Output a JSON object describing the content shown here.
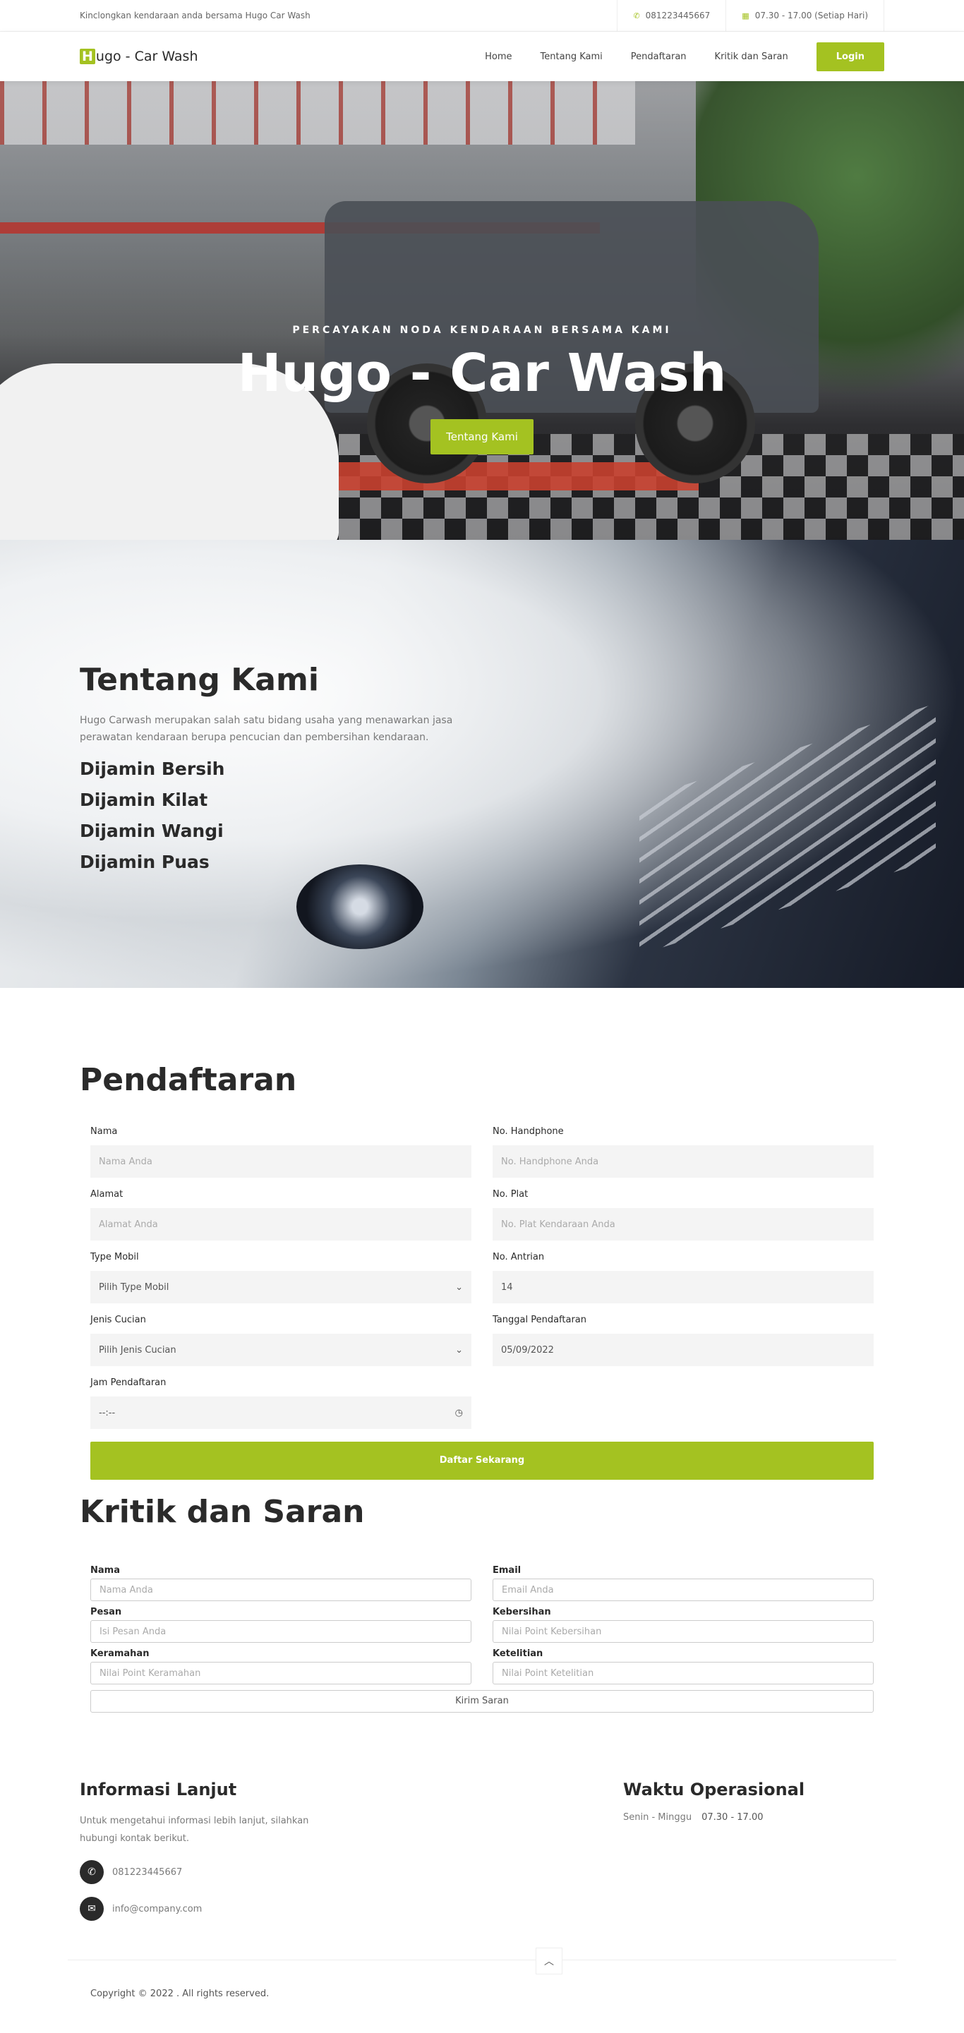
{
  "topbar": {
    "tagline": "Kinclongkan kendaraan anda bersama Hugo Car Wash",
    "phone": "081223445667",
    "hours": "07.30 - 17.00 (Setiap Hari)"
  },
  "nav": {
    "logo_mark": "H",
    "logo_text": "ugo - Car Wash",
    "links": [
      "Home",
      "Tentang Kami",
      "Pendaftaran",
      "Kritik dan Saran"
    ],
    "login": "Login"
  },
  "hero": {
    "subtitle": "PERCAYAKAN NODA KENDARAAN BERSAMA KAMI",
    "title": "Hugo - Car Wash",
    "button": "Tentang Kami",
    "slides": 3,
    "active_slide": 1
  },
  "about": {
    "title": "Tentang Kami",
    "description": "Hugo Carwash merupakan salah satu bidang usaha yang menawarkan jasa perawatan kendaraan berupa pencucian dan pembersihan kendaraan.",
    "points": [
      "Dijamin Bersih",
      "Dijamin Kilat",
      "Dijamin Wangi",
      "Dijamin Puas"
    ]
  },
  "pendaftaran": {
    "title": "Pendaftaran",
    "fields": {
      "nama": {
        "label": "Nama",
        "placeholder": "Nama Anda"
      },
      "hp": {
        "label": "No. Handphone",
        "placeholder": "No. Handphone Anda"
      },
      "alamat": {
        "label": "Alamat",
        "placeholder": "Alamat Anda"
      },
      "plat": {
        "label": "No. Plat",
        "placeholder": "No. Plat Kendaraan Anda"
      },
      "type": {
        "label": "Type Mobil",
        "value": "Pilih Type Mobil"
      },
      "antrian": {
        "label": "No. Antrian",
        "value": "14"
      },
      "jenis": {
        "label": "Jenis Cucian",
        "value": "Pilih Jenis Cucian"
      },
      "tanggal": {
        "label": "Tanggal Pendaftaran",
        "value": "05/09/2022"
      },
      "jam": {
        "label": "Jam Pendaftaran",
        "value": "--:--"
      }
    },
    "submit": "Daftar Sekarang"
  },
  "kritik": {
    "title": "Kritik dan Saran",
    "fields": {
      "nama": {
        "label": "Nama",
        "placeholder": "Nama Anda"
      },
      "email": {
        "label": "Email",
        "placeholder": "Email Anda"
      },
      "pesan": {
        "label": "Pesan",
        "placeholder": "Isi Pesan Anda"
      },
      "kebersihan": {
        "label": "Kebersihan",
        "placeholder": "Nilai Point Kebersihan"
      },
      "keramahan": {
        "label": "Keramahan",
        "placeholder": "Nilai Point Keramahan"
      },
      "ketelitian": {
        "label": "Ketelitian",
        "placeholder": "Nilai Point Ketelitian"
      }
    },
    "submit": "Kirim Saran"
  },
  "footer": {
    "info_title": "Informasi Lanjut",
    "info_text": "Untuk mengetahui informasi lebih lanjut, silahkan hubungi kontak berikut.",
    "phone": "081223445667",
    "email": "info@company.com",
    "ops_title": "Waktu Operasional",
    "ops_days": "Senin - Minggu",
    "ops_time": "07.30 - 17.00",
    "copyright": "Copyright © 2022 . All rights reserved."
  },
  "icons": {
    "phone": "phone-icon",
    "calendar": "calendar-icon",
    "chevron": "chevron-down-icon",
    "clock": "clock-icon",
    "email": "envelope-icon",
    "up": "chevron-up-icon"
  },
  "colors": {
    "accent": "#a4c221",
    "text": "#2a2a2a"
  }
}
